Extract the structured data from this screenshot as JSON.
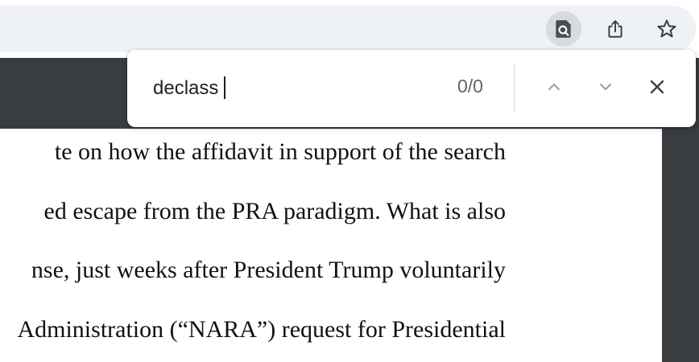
{
  "toolbar": {
    "icons": [
      "search-in-page-icon",
      "share-icon",
      "bookmark-star-icon"
    ]
  },
  "find_bar": {
    "query": "declass",
    "match_count": "0/0",
    "icons": [
      "chevron-up-icon",
      "chevron-down-icon",
      "close-icon"
    ]
  },
  "document": {
    "lines": [
      "te on how the affidavit in support of the search",
      "ed escape from the PRA paradigm.  What is also",
      "nse, just weeks after President Trump voluntarily",
      "Administration (“NARA”) request for Presidential"
    ]
  },
  "colors": {
    "toolbar_bg": "#ffffff",
    "omnibox_bg": "#eef1f5",
    "active_icon_bg": "#d7dbe0",
    "pdf_viewer_bg": "#3a3d40",
    "page_bg": "#ffffff"
  }
}
